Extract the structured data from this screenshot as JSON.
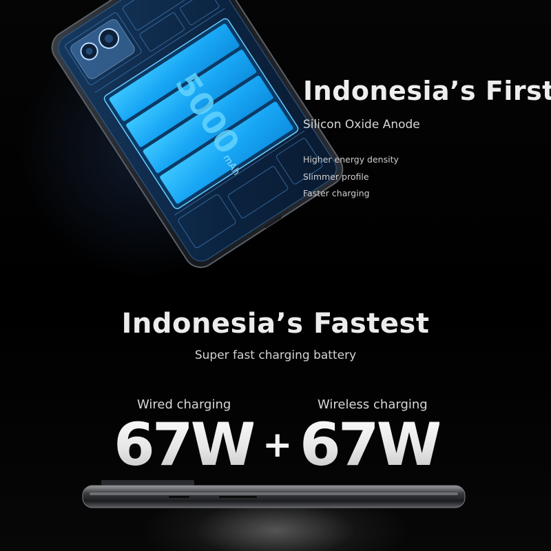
{
  "hero": {
    "headline": "Indonesia’s First",
    "subtitle": "Silicon Oxide Anode",
    "features": [
      "Higher energy density",
      "Slimmer profile",
      "Faster charging"
    ]
  },
  "battery": {
    "capacity": "5000",
    "unit": "mAh"
  },
  "charging": {
    "headline": "Indonesia’s Fastest",
    "subtitle": "Super fast charging battery",
    "wired_label": "Wired charging",
    "wired_power": "67W",
    "plus": "+",
    "wireless_label": "Wireless charging",
    "wireless_power": "67W"
  },
  "colors": {
    "background": "#000000",
    "battery_blue": "#1fb0ff",
    "text": "#eeeeee"
  }
}
